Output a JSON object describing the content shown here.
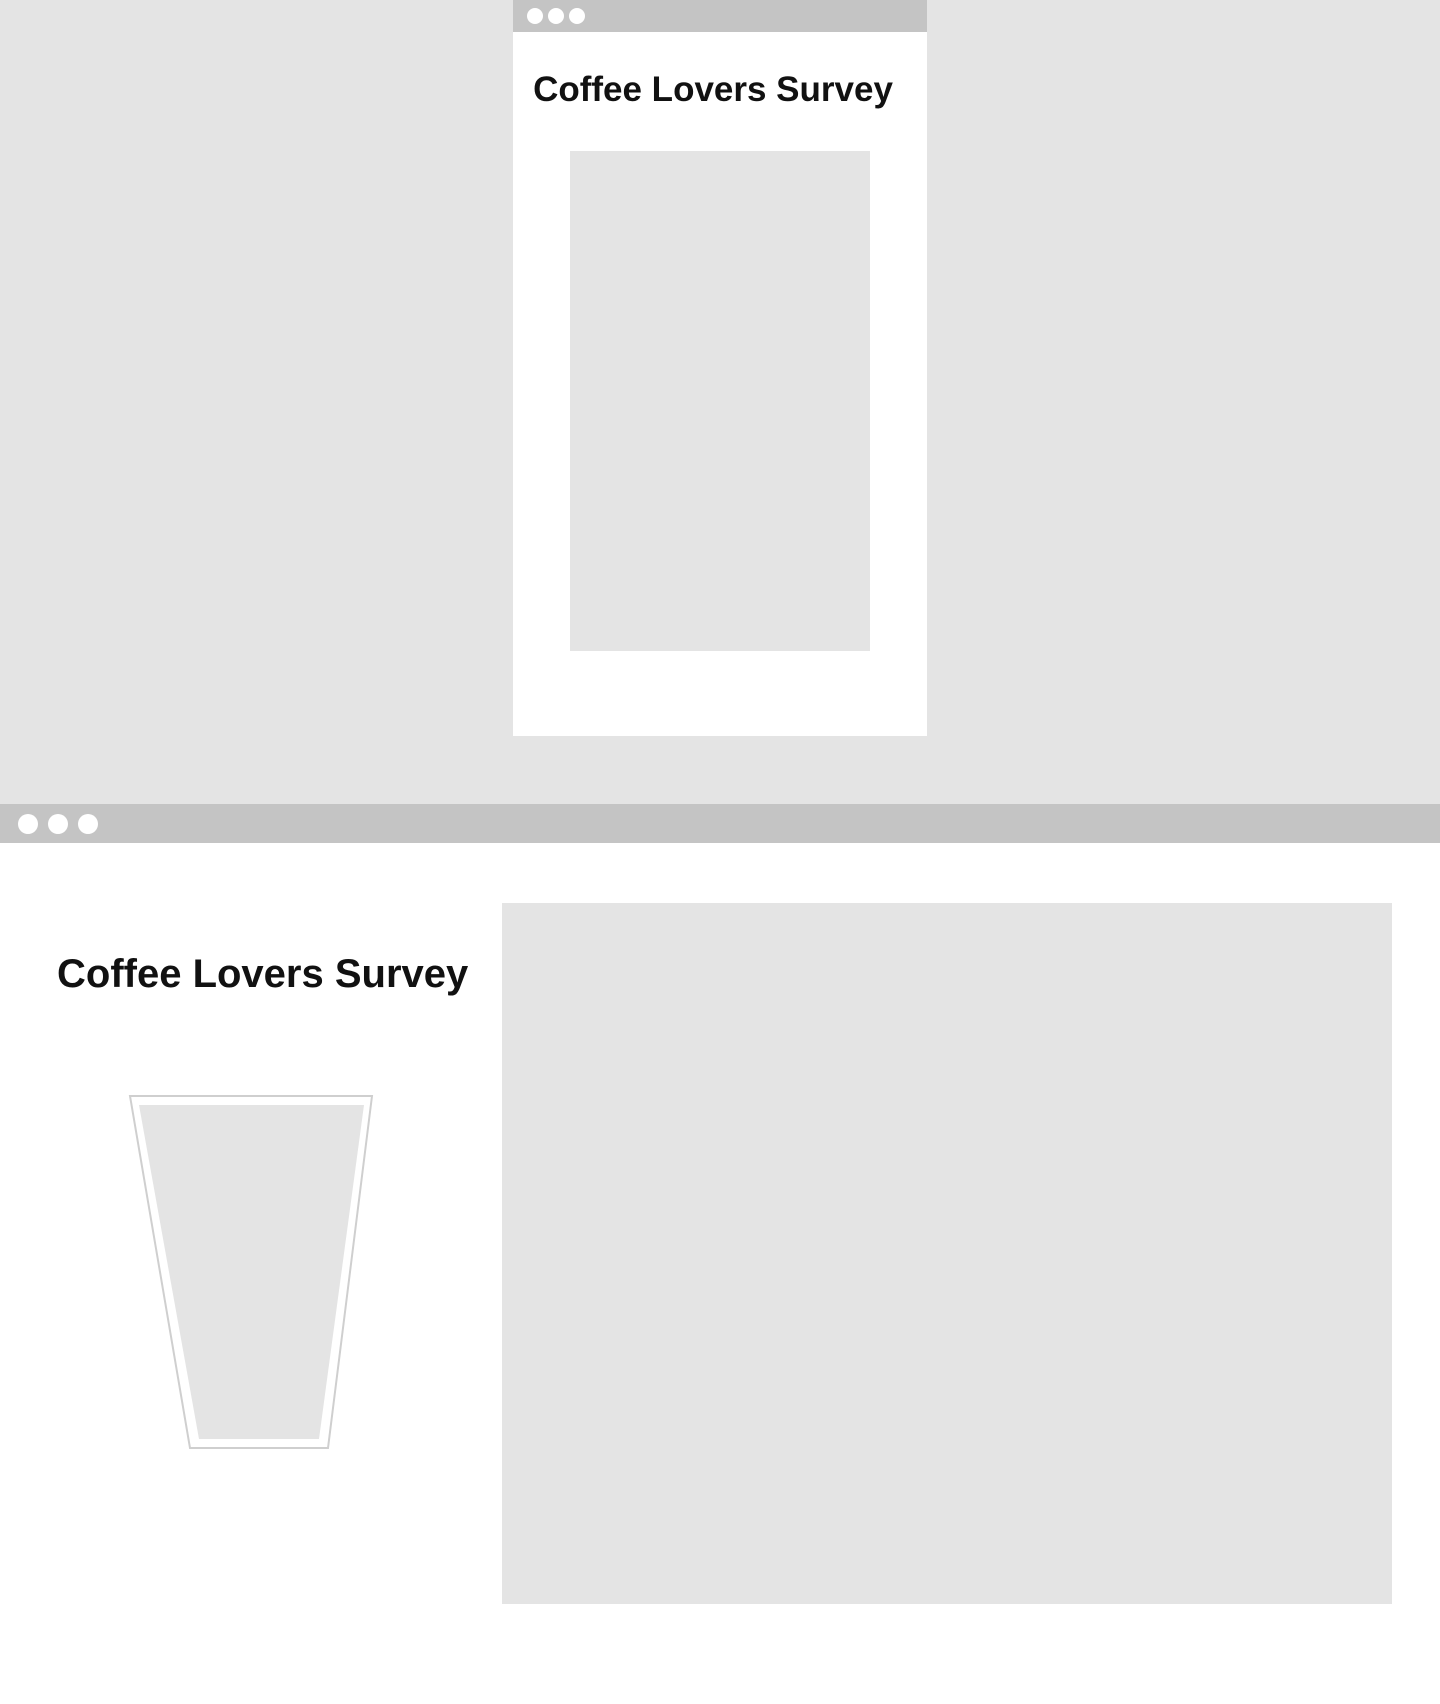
{
  "colors": {
    "page_background": "#e4e4e4",
    "window_bar": "#c4c4c4",
    "window_dot": "#ffffff",
    "window_surface": "#ffffff",
    "placeholder": "#e4e4e4",
    "cup_outline": "#cfcfcf",
    "text": "#111111"
  },
  "mobile": {
    "title": "Coffee Lovers Survey",
    "window_controls": [
      "window-dot",
      "window-dot",
      "window-dot"
    ],
    "content_placeholder": "image-placeholder"
  },
  "desktop": {
    "title": "Coffee Lovers Survey",
    "window_controls": [
      "window-dot",
      "window-dot",
      "window-dot"
    ],
    "illustration": "coffee-cup-icon",
    "content_placeholder": "image-placeholder"
  }
}
